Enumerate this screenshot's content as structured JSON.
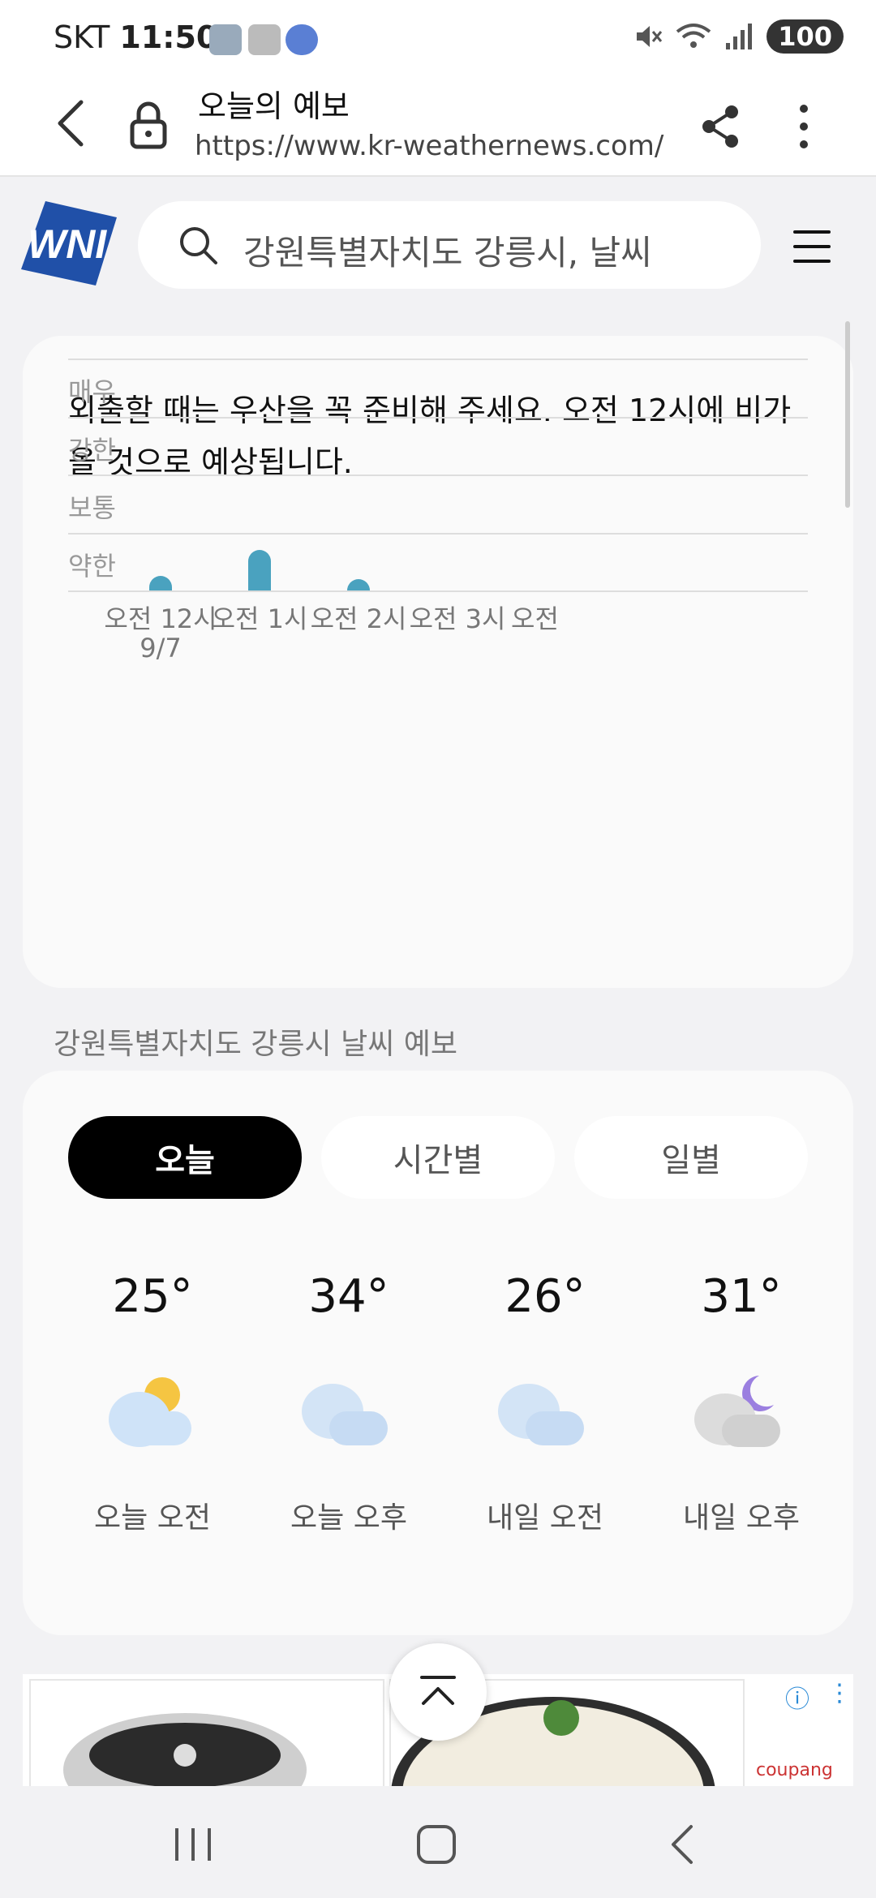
{
  "status_bar": {
    "carrier": "SKT",
    "time": "11:50",
    "battery": "100"
  },
  "browser": {
    "page_title": "오늘의 예보",
    "url": "https://www.kr-weathernews.com/r"
  },
  "site": {
    "logo_text": "WNI",
    "search_text": "강원특별자치도 강릉시, 날씨"
  },
  "rain_card": {
    "message": "외출할 때는 우산을 꼭 준비해 주세요. 오전 12시에 비가 올 것으로 예상됩니다.",
    "chart_data": {
      "type": "bar",
      "y_levels": [
        "약한",
        "보통",
        "강한",
        "매우"
      ],
      "categories": [
        "오전 12시",
        "오전 1시",
        "오전 2시",
        "오전 3시",
        "오전"
      ],
      "first_category_date": "9/7",
      "values": [
        0.25,
        0.7,
        0.2,
        0,
        0
      ],
      "ylim": [
        0,
        4
      ],
      "bar_color": "#4aa2bf",
      "grid": true
    }
  },
  "forecast": {
    "section_title": "강원특별자치도 강릉시 날씨 예보",
    "tabs": [
      {
        "label": "오늘",
        "active": true
      },
      {
        "label": "시간별",
        "active": false
      },
      {
        "label": "일별",
        "active": false
      }
    ],
    "periods": [
      {
        "temp": "25°",
        "label": "오늘 오전",
        "icon": "partly-cloudy-day-icon"
      },
      {
        "temp": "34°",
        "label": "오늘 오후",
        "icon": "cloudy-icon"
      },
      {
        "temp": "26°",
        "label": "내일 오전",
        "icon": "cloudy-icon"
      },
      {
        "temp": "31°",
        "label": "내일 오후",
        "icon": "cloudy-night-icon"
      }
    ]
  },
  "ad": {
    "brand": "coupang"
  }
}
